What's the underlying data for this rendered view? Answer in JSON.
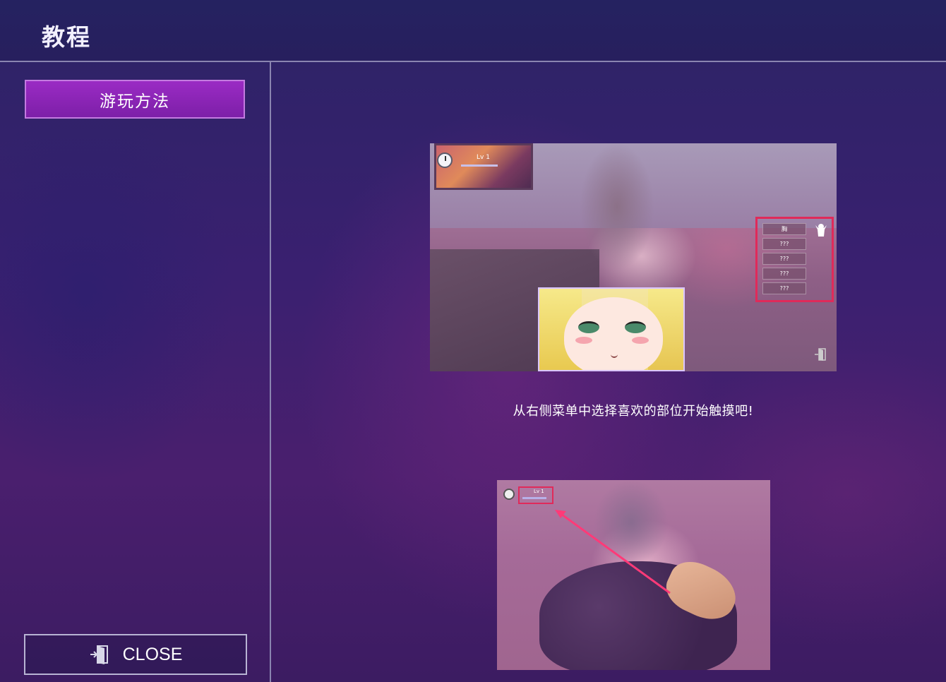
{
  "header": {
    "title": "教程"
  },
  "sidebar": {
    "tabs": [
      {
        "label": "游玩方法",
        "active": true
      }
    ],
    "close_label": "CLOSE"
  },
  "content": {
    "caption": "从右侧菜单中选择喜欢的部位开始触摸吧!",
    "screenshot1": {
      "lv_text": "Lv 1",
      "menu_items": [
        "胸",
        "???",
        "???",
        "???",
        "???"
      ],
      "icons": [
        "clock-icon",
        "body-select-icon",
        "exit-door-icon"
      ]
    },
    "screenshot2": {
      "lv_text": "Lv 1",
      "icons": [
        "clock-icon"
      ]
    }
  },
  "colors": {
    "accent_tab": "#8a24b8",
    "highlight_box": "#e02a5a",
    "divider": "#8a85b0"
  }
}
